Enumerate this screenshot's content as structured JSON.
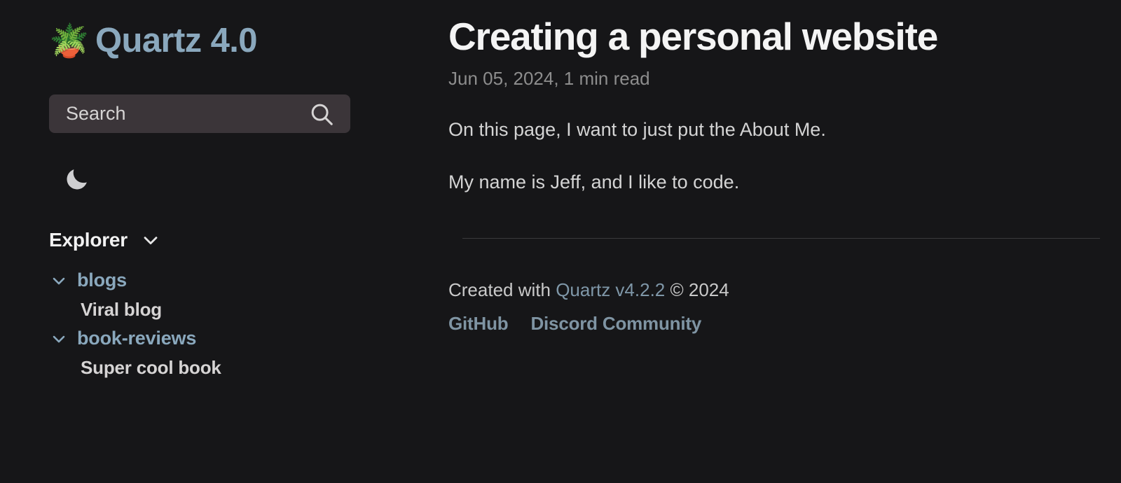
{
  "site": {
    "brand_emoji": "🪴",
    "brand_emoji_name": "potted-plant-icon",
    "brand_title": "Quartz 4.0",
    "accent_color": "#8aa8bd",
    "background_color": "#161618",
    "search_field_color": "#3b3539",
    "body_text_color": "#d4d4d4",
    "muted_text_color": "#8d8d8d"
  },
  "search": {
    "placeholder": "Search",
    "value": "",
    "icon": "search-icon"
  },
  "theme_toggle": {
    "icon": "moon-icon",
    "mode": "dark"
  },
  "explorer": {
    "title": "Explorer",
    "chevron_icon": "chevron-down-icon",
    "expanded": true,
    "tree": [
      {
        "type": "folder",
        "label": "blogs",
        "expanded": true,
        "chevron_icon": "chevron-down-icon",
        "children": [
          {
            "type": "file",
            "label": "Viral blog"
          }
        ]
      },
      {
        "type": "folder",
        "label": "book-reviews",
        "expanded": true,
        "chevron_icon": "chevron-down-icon",
        "children": [
          {
            "type": "file",
            "label": "Super cool book"
          }
        ]
      }
    ]
  },
  "article": {
    "title": "Creating a personal website",
    "meta": "Jun 05, 2024, 1 min read",
    "date": "Jun 05, 2024",
    "read_time": "1 min read",
    "paragraphs": [
      "On this page, I want to just put the About Me.",
      "My name is Jeff, and I like to code."
    ]
  },
  "footer": {
    "credit_prefix": "Created with ",
    "credit_link": "Quartz v4.2.2",
    "credit_suffix": " © 2024",
    "links": [
      {
        "label": "GitHub"
      },
      {
        "label": "Discord Community"
      }
    ]
  }
}
